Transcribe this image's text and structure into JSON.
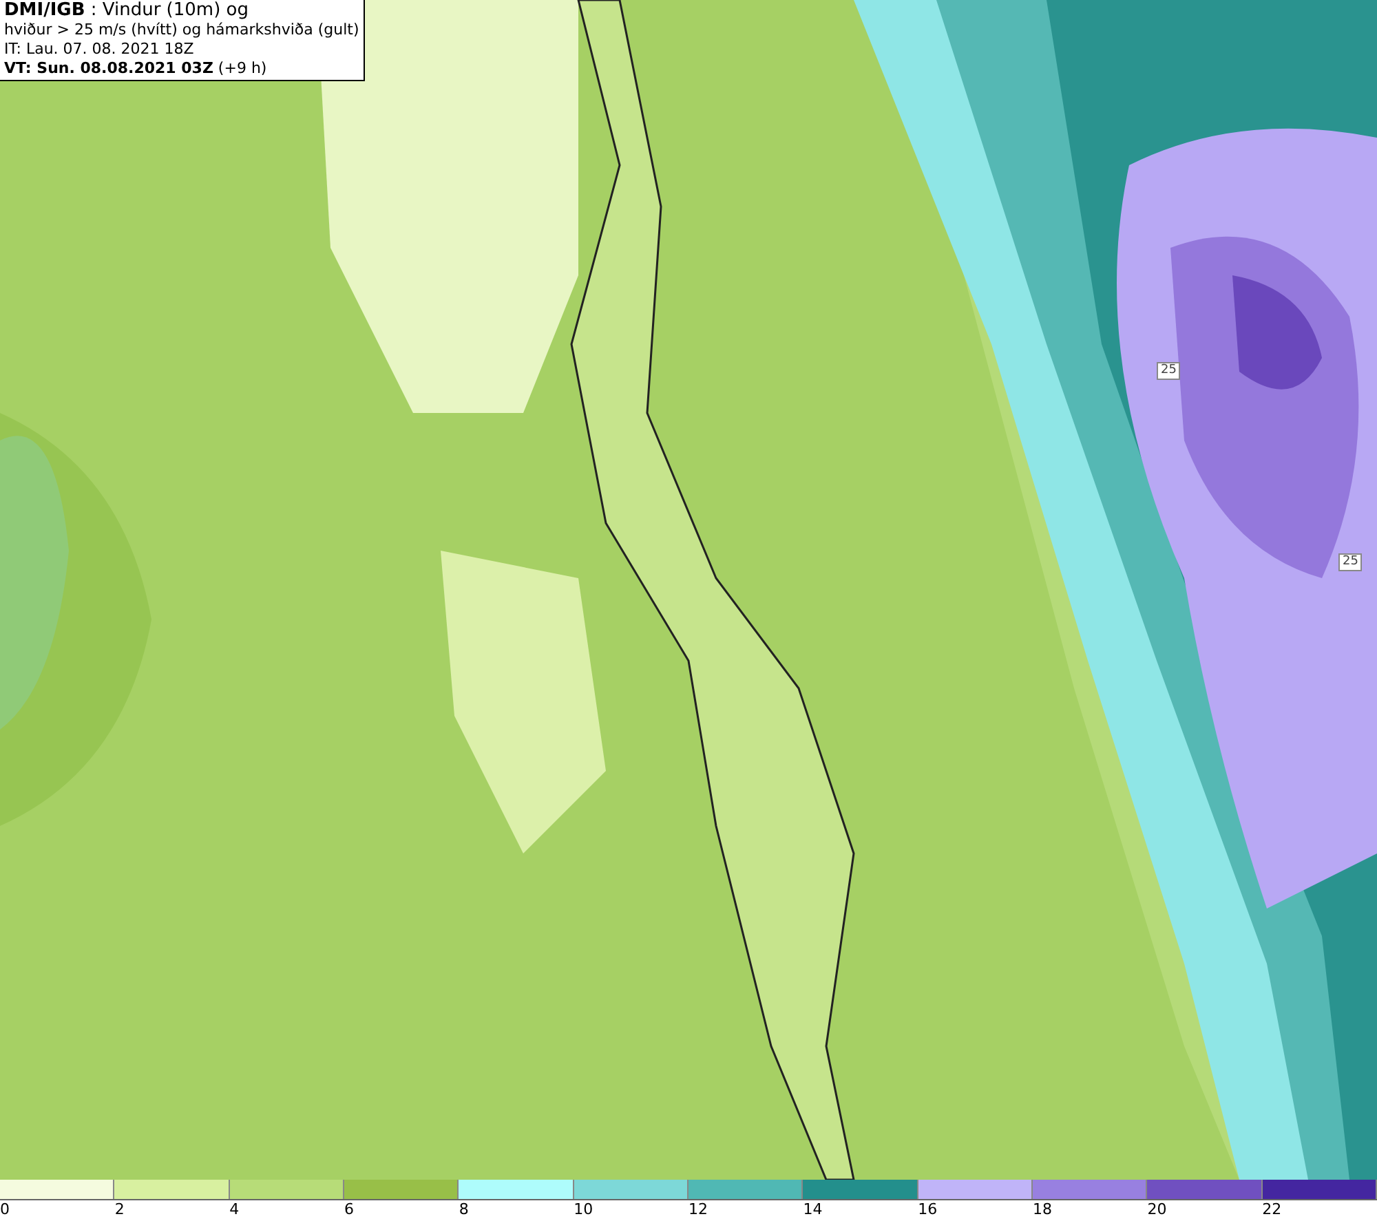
{
  "header": {
    "lines": [
      "**DMI/IGB** : Vindur (10m) og",
      "hviður > 25 m/s (hvítt) og hámarkshviða (gult)",
      "IT: Lau. 07. 08. 2021 18Z",
      "**VT: Sun. 08.08.2021 03Z** (+9 h)"
    ]
  },
  "map": {
    "contour_labels": [
      "25",
      "25"
    ]
  },
  "legend": {
    "bins": [
      {
        "label": "0",
        "color": "#f5fbdf"
      },
      {
        "label": "2",
        "color": "#d8f0a0"
      },
      {
        "label": "4",
        "color": "#b7dc78"
      },
      {
        "label": "6",
        "color": "#98bf48"
      },
      {
        "label": "8",
        "color": "#aefcfc"
      },
      {
        "label": "10",
        "color": "#7dd8d8"
      },
      {
        "label": "12",
        "color": "#50b8b4"
      },
      {
        "label": "14",
        "color": "#238f8c"
      },
      {
        "label": "16",
        "color": "#c0b4f8"
      },
      {
        "label": "18",
        "color": "#9880e0"
      },
      {
        "label": "20",
        "color": "#7050c0"
      },
      {
        "label": "22",
        "color": "#4426a0"
      }
    ]
  }
}
